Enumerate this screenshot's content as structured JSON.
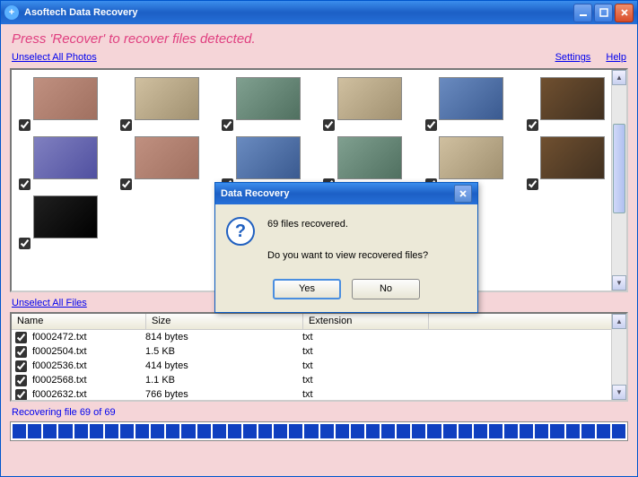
{
  "window": {
    "title": "Asoftech Data Recovery",
    "instruction": "Press 'Recover' to recover files detected.",
    "unselect_photos": "Unselect All Photos",
    "unselect_files": "Unselect All Files",
    "settings": "Settings",
    "help": "Help"
  },
  "photos": {
    "count": 13
  },
  "file_table": {
    "headers": {
      "name": "Name",
      "size": "Size",
      "ext": "Extension"
    },
    "rows": [
      {
        "name": "f0002472.txt",
        "size": "814 bytes",
        "ext": "txt"
      },
      {
        "name": "f0002504.txt",
        "size": "1.5 KB",
        "ext": "txt"
      },
      {
        "name": "f0002536.txt",
        "size": "414 bytes",
        "ext": "txt"
      },
      {
        "name": "f0002568.txt",
        "size": "1.1 KB",
        "ext": "txt"
      },
      {
        "name": "f0002632.txt",
        "size": "766 bytes",
        "ext": "txt"
      }
    ]
  },
  "status": "Recovering file 69 of 69",
  "dialog": {
    "title": "Data Recovery",
    "line1": "69 files recovered.",
    "line2": "Do you want to view recovered files?",
    "yes": "Yes",
    "no": "No"
  }
}
